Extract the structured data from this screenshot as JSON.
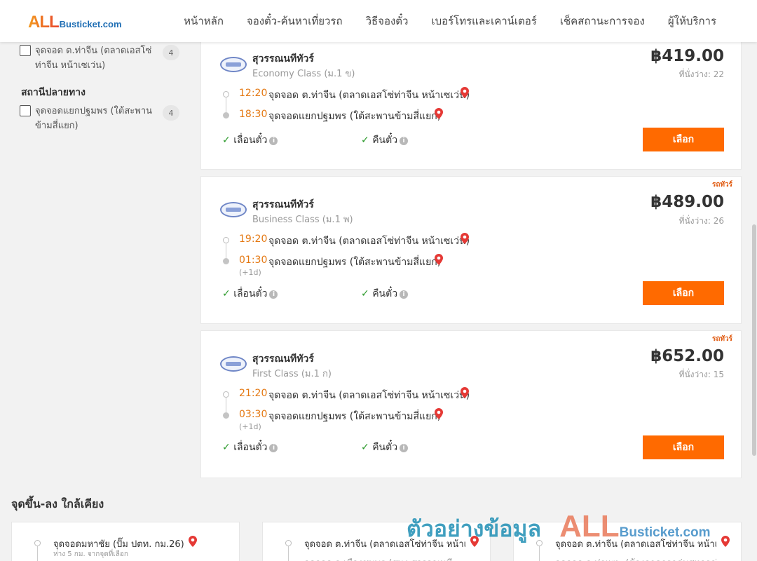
{
  "brand": {
    "logo_all": "ALL",
    "logo_rest": "Busticket.com"
  },
  "nav": [
    "หน้าหลัก",
    "จองตั๋ว-ค้นหาเที่ยวรถ",
    "วิธีจองตั๋ว",
    "เบอร์โทรและเคาน์เตอร์",
    "เช็คสถานะการจอง",
    "ผู้ให้บริการ"
  ],
  "sidebar": {
    "origin_filter": {
      "label": "จุดจอด ต.ท่าจีน (ตลาดเอสโซ่ท่าจีน หน้าเซเว่น)",
      "count": "4"
    },
    "destination_title": "สถานีปลายทาง",
    "destination_filter": {
      "label": "จุดจอดแยกปฐมพร (ใต้สะพานข้ามสี่แยก)",
      "count": "4"
    }
  },
  "trips": [
    {
      "operator": "สุวรรณนทีทัวร์",
      "class": "Economy Class (ม.1 ข)",
      "price": "฿419.00",
      "seats": "ที่นั่งว่าง: 22",
      "badge": "",
      "depart_time": "12:20",
      "depart_place": "จุดจอด ต.ท่าจีน (ตลาดเอสโซ่ท่าจีน หน้าเซเว่น)",
      "arrive_time": "18:30",
      "arrive_place": "จุดจอดแยกปฐมพร (ใต้สะพานข้ามสี่แยก)",
      "next_day": "",
      "feature1": "เลื่อนตั๋ว",
      "feature2": "คืนตั๋ว",
      "select": "เลือก"
    },
    {
      "operator": "สุวรรณนทีทัวร์",
      "class": "Business Class (ม.1 พ)",
      "price": "฿489.00",
      "seats": "ที่นั่งว่าง: 26",
      "badge": "รถทัวร์",
      "depart_time": "19:20",
      "depart_place": "จุดจอด ต.ท่าจีน (ตลาดเอสโซ่ท่าจีน หน้าเซเว่น)",
      "arrive_time": "01:30",
      "arrive_place": "จุดจอดแยกปฐมพร (ใต้สะพานข้ามสี่แยก)",
      "next_day": "(+1d)",
      "feature1": "เลื่อนตั๋ว",
      "feature2": "คืนตั๋ว",
      "select": "เลือก"
    },
    {
      "operator": "สุวรรณนทีทัวร์",
      "class": "First Class (ม.1 ก)",
      "price": "฿652.00",
      "seats": "ที่นั่งว่าง: 15",
      "badge": "รถทัวร์",
      "depart_time": "21:20",
      "depart_place": "จุดจอด ต.ท่าจีน (ตลาดเอสโซ่ท่าจีน หน้าเซเว่น)",
      "arrive_time": "03:30",
      "arrive_place": "จุดจอดแยกปฐมพร (ใต้สะพานข้ามสี่แยก)",
      "next_day": "(+1d)",
      "feature1": "เลื่อนตั๋ว",
      "feature2": "คืนตั๋ว",
      "select": "เลือก"
    }
  ],
  "nearby": {
    "title": "จุดขึ้น-ลง ใกล้เคียง",
    "items": [
      {
        "place": "จุดจอดมหาชัย (ปั๊ม ปตท. กม.26)",
        "sub": "ห่าง 5 กม. จากจุดที่เลือก",
        "place2": ""
      },
      {
        "place": "จุดจอด ต.ท่าจีน (ตลาดเอสโซ่ท่าจีน หน้าเซเว่น)",
        "sub": "",
        "place2": "จุดจอด อ.เมืองชุมพร (สนง.สุวรรณนที"
      },
      {
        "place": "จุดจอด ต.ท่าจีน (ตลาดเอสโซ่ท่าจีน หน้าเซเว่น)",
        "sub": "",
        "place2": "จุดจอด อ.ท่าแซะ (ข้างอาคารกลุ่มสหกรณ์"
      }
    ]
  },
  "watermark": {
    "text": "ตัวอย่างข้อมูล",
    "all": "ALL",
    "rest": "Busticket.com"
  },
  "colors": {
    "accent": "#ff6a00",
    "time": "#e47812",
    "pin": "#e53935",
    "check": "#2b9a2b"
  }
}
